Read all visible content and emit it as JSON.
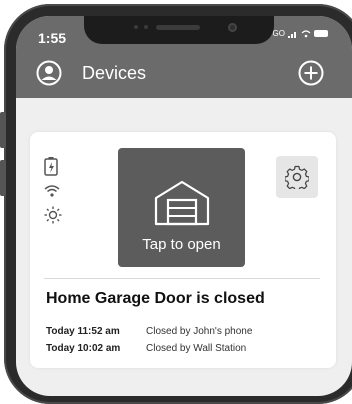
{
  "status_bar": {
    "time": "1:55",
    "carrier": "GO"
  },
  "header": {
    "title": "Devices",
    "profile_icon": "profile-icon",
    "add_icon": "plus-circle-icon"
  },
  "device_card": {
    "status_icons": [
      "battery-charging-icon",
      "wifi-icon",
      "sun-icon"
    ],
    "open_button": {
      "icon": "garage-door-icon",
      "label": "Tap to open"
    },
    "settings_icon": "gear-icon",
    "status_title": "Home Garage Door is closed",
    "history": [
      {
        "time": "Today 11:52 am",
        "event": "Closed by John's phone"
      },
      {
        "time": "Today 10:02 am",
        "event": "Closed by Wall Station"
      }
    ]
  }
}
